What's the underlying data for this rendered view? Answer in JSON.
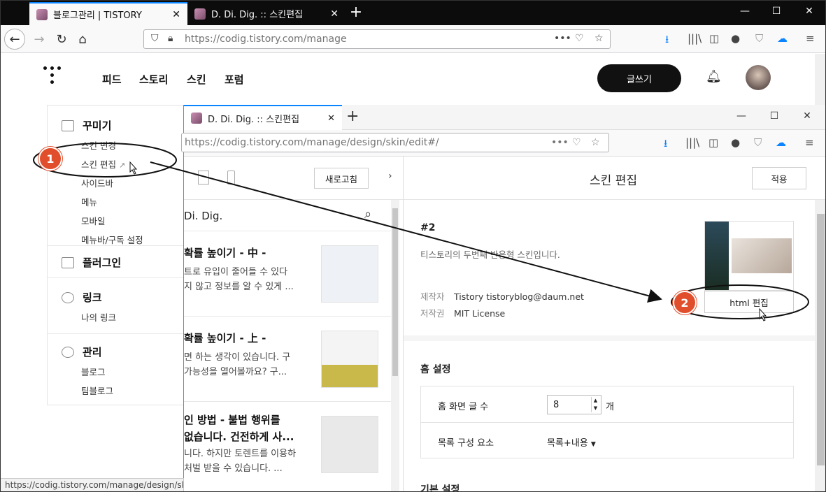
{
  "browser": {
    "tabs": [
      {
        "title": "블로그관리 | TISTORY"
      },
      {
        "title": "D. Di. Dig. :: 스킨편집"
      }
    ],
    "url": "https://codig.tistory.com/manage",
    "status_url": "https://codig.tistory.com/manage/design/skin/e"
  },
  "header": {
    "nav": [
      "피드",
      "스토리",
      "스킨",
      "포럼"
    ],
    "write_label": "글쓰기"
  },
  "sidebar": {
    "groups": [
      {
        "title": "꾸미기",
        "items": [
          "스킨 변경",
          "스킨 편집",
          "사이드바",
          "메뉴",
          "모바일",
          "메뉴바/구독 설정"
        ]
      },
      {
        "title": "플러그인",
        "items": []
      },
      {
        "title": "링크",
        "items": [
          "나의 링크"
        ]
      },
      {
        "title": "관리",
        "items": [
          "블로그",
          "팀블로그"
        ]
      }
    ]
  },
  "window2": {
    "tab_title": "D. Di. Dig. :: 스킨편집",
    "url": "https://codig.tistory.com/manage/design/skin/edit#/",
    "preview": {
      "refresh_label": "새로고침",
      "blog_name": "Di. Dig.",
      "posts": [
        {
          "title": "확률 높이기 - 中 -",
          "excerpt": [
            "트로 유입이 줄어들 수 있다",
            "지 않고 정보를 알 수 있게 ..."
          ]
        },
        {
          "title": "확률 높이기 - 上 -",
          "excerpt": [
            "면 하는 생각이 있습니다. 구",
            "가능성을 열어볼까요? 구..."
          ]
        },
        {
          "title": "인 방법 - 불법 행위를",
          "title2": "없습니다. 건전하게 사...",
          "excerpt": [
            "니다. 하지만 토렌트를 이용하",
            "처벌 받을 수 있습니다. ..."
          ]
        }
      ]
    },
    "editor": {
      "title": "스킨 편집",
      "apply_label": "적용",
      "skin_no": "#2",
      "skin_desc": "티스토리의 두번째 반응형 스킨입니다.",
      "maker_label": "제작자",
      "maker_value": "Tistory tistoryblog@daum.net",
      "license_label": "저작권",
      "license_value": "MIT License",
      "html_edit_label": "html 편집",
      "home_title": "홈 설정",
      "home_rows": [
        {
          "label": "홈 화면 글 수",
          "value": "8",
          "unit": "개"
        },
        {
          "label": "목록 구성 요소",
          "value": "목록+내용"
        }
      ],
      "basic_title": "기본 설정"
    }
  },
  "annotations": {
    "step1": "1",
    "step2": "2"
  },
  "colors": {
    "accent": "#0a84ff",
    "badge": "#e04e2c"
  }
}
